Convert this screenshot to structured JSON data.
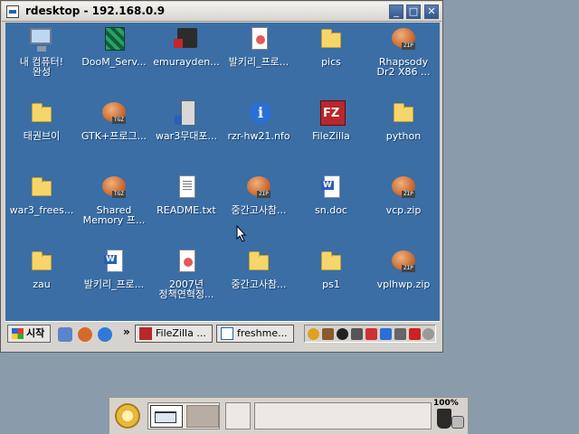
{
  "window": {
    "title": "rdesktop - 192.168.0.9",
    "controls": {
      "minimize": "_",
      "maximize": "□",
      "close": "✕"
    }
  },
  "desktop": {
    "icons": [
      {
        "label": "내 컴퓨터!\n완성",
        "icon": "monitor-icon"
      },
      {
        "label": "DooM_Serv...",
        "icon": "archive-icon"
      },
      {
        "label": "emurayden...",
        "icon": "device-icon"
      },
      {
        "label": "발키리_프로...",
        "icon": "pdf-icon"
      },
      {
        "label": "pics",
        "icon": "folder-icon"
      },
      {
        "label": "Rhapsody\nDr2 X86 ...",
        "icon": "zip-icon"
      },
      {
        "label": "태권브이",
        "icon": "folder-icon"
      },
      {
        "label": "GTK+프로그...",
        "icon": "tgz-icon"
      },
      {
        "label": "war3무대포...",
        "icon": "server-icon"
      },
      {
        "label": "rzr-hw21.nfo",
        "icon": "info-icon"
      },
      {
        "label": "FileZilla",
        "icon": "filezilla-icon"
      },
      {
        "label": "python",
        "icon": "folder-icon"
      },
      {
        "label": "war3_frees...",
        "icon": "folder-icon"
      },
      {
        "label": "Shared\nMemory 프...",
        "icon": "tgz-icon"
      },
      {
        "label": "README.txt",
        "icon": "text-file-icon"
      },
      {
        "label": "중간고사참...",
        "icon": "zip-icon"
      },
      {
        "label": "sn.doc",
        "icon": "word-doc-icon"
      },
      {
        "label": "vcp.zip",
        "icon": "zip-icon"
      },
      {
        "label": "zau",
        "icon": "folder-icon"
      },
      {
        "label": "발키리_프로...",
        "icon": "word-doc-icon"
      },
      {
        "label": "2007년\n정책연혁정...",
        "icon": "pdf-icon"
      },
      {
        "label": "중간고사참...",
        "icon": "folder-icon"
      },
      {
        "label": "ps1",
        "icon": "folder-icon"
      },
      {
        "label": "vplhwp.zip",
        "icon": "zip-icon"
      }
    ],
    "badges": {
      "zip": "ZIP",
      "tgz": "TGZ"
    }
  },
  "remote_taskbar": {
    "start_label": "시작",
    "overflow": "»",
    "tasks": [
      {
        "label": "FileZilla ...",
        "icon": "filezilla-icon"
      },
      {
        "label": "freshme...",
        "icon": "document-icon"
      }
    ]
  },
  "host_panel": {
    "battery_text": "100%"
  },
  "colors": {
    "desktop_bg": "#3a6ea5",
    "host_bg": "#8a9bab",
    "title_button": "#35578c"
  }
}
